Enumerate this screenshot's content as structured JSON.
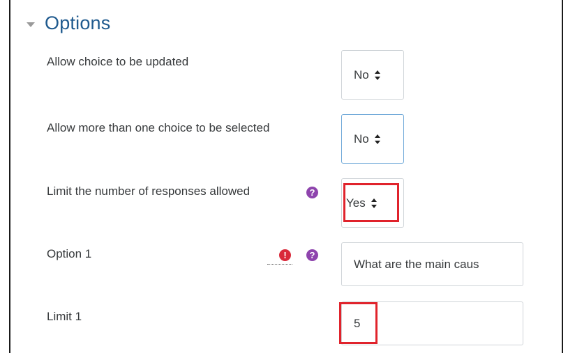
{
  "section": {
    "title": "Options"
  },
  "fields": {
    "allow_update": {
      "label": "Allow choice to be updated",
      "value": "No"
    },
    "allow_multiple": {
      "label": "Allow more than one choice to be selected",
      "value": "No"
    },
    "limit_responses": {
      "label": "Limit the number of responses allowed",
      "value": "Yes"
    },
    "option1": {
      "label": "Option 1",
      "value": "What are the main caus"
    },
    "limit1": {
      "label": "Limit 1",
      "value": "5"
    }
  },
  "icons": {
    "help": "question-circle-icon",
    "error": "exclamation-circle-icon"
  },
  "colors": {
    "title": "#1f5a8e",
    "help": "#8e44ad",
    "error": "#d9293a",
    "highlight": "#e0232c"
  }
}
